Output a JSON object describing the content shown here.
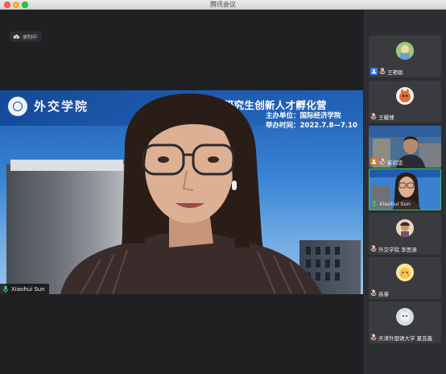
{
  "window": {
    "title": "腾讯会议"
  },
  "recording": {
    "label": "录制中"
  },
  "main_video": {
    "speaker_name": "Xiaohui Sun",
    "slide": {
      "school_name": "外交学院",
      "headline": "2年研究生创新人才孵化营",
      "organizer": "主办单位：国际经济学院",
      "dates": "举办时间：2022.7.8—7.10"
    }
  },
  "participants": [
    {
      "name": "王艳聪",
      "badge": "host-icon",
      "mic": "muted"
    },
    {
      "name": "王耀博",
      "badge": "",
      "mic": "muted"
    },
    {
      "name": "崔绍忠",
      "badge": "cohost-icon",
      "mic": "muted"
    },
    {
      "name": "Xiaohui Sun",
      "badge": "",
      "mic": "speaking"
    },
    {
      "name": "外交学院 李思涵",
      "badge": "",
      "mic": "muted"
    },
    {
      "name": "高睿",
      "badge": "",
      "mic": "muted"
    },
    {
      "name": "天津外国语大学 夏蕊鑫",
      "badge": "",
      "mic": "muted"
    }
  ],
  "colors": {
    "active_speaker": "#3ec26a",
    "host_badge": "#2f7cf6",
    "cohost_badge": "#e07a2a",
    "muted_mic": "#e84a4a",
    "speaking_mic": "#3ec26a"
  }
}
